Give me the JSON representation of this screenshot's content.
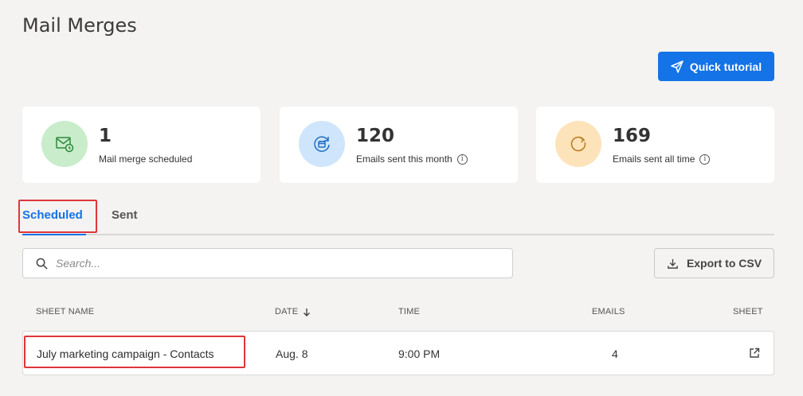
{
  "page": {
    "title": "Mail Merges"
  },
  "header": {
    "tutorial_label": "Quick tutorial"
  },
  "stats": [
    {
      "value": "1",
      "label": "Mail merge scheduled",
      "icon": "mail-clock-icon",
      "color": "#c9eccb"
    },
    {
      "value": "120",
      "label": "Emails sent this month",
      "icon": "calendar-refresh-icon",
      "color": "#cfe5fb"
    },
    {
      "value": "169",
      "label": "Emails sent all time",
      "icon": "refresh-dashed-icon",
      "color": "#fde3ba"
    }
  ],
  "tabs": [
    {
      "label": "Scheduled",
      "active": true
    },
    {
      "label": "Sent",
      "active": false
    }
  ],
  "search": {
    "placeholder": "Search..."
  },
  "export": {
    "label": "Export to CSV"
  },
  "table": {
    "columns": [
      "SHEET NAME",
      "DATE",
      "TIME",
      "EMAILS",
      "SHEET"
    ],
    "rows": [
      {
        "sheet_name": "July marketing campaign - Contacts",
        "date": "Aug. 8",
        "time": "9:00 PM",
        "emails": "4"
      }
    ]
  },
  "colors": {
    "accent": "#1473e6",
    "highlight": "#e0353b",
    "background": "#f4f3f1"
  }
}
